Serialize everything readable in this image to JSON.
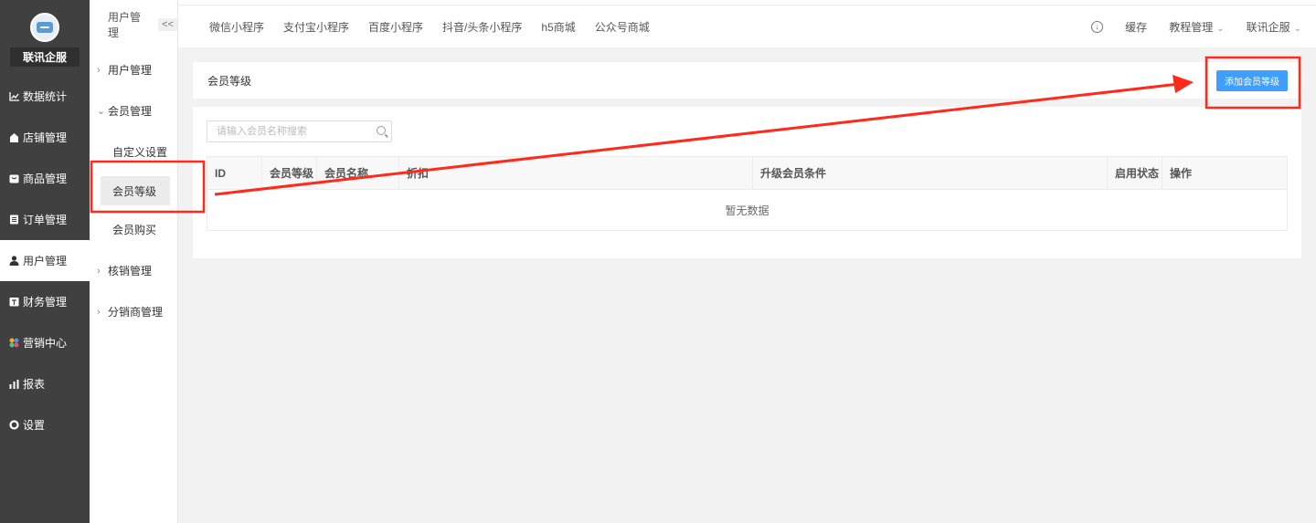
{
  "sidebar": {
    "brand": "联讯企服",
    "items": [
      {
        "label": "数据统计",
        "icon": "chart-icon"
      },
      {
        "label": "店铺管理",
        "icon": "store-icon"
      },
      {
        "label": "商品管理",
        "icon": "goods-icon"
      },
      {
        "label": "订单管理",
        "icon": "order-icon"
      },
      {
        "label": "用户管理",
        "icon": "user-icon",
        "active": true
      },
      {
        "label": "财务管理",
        "icon": "finance-icon"
      },
      {
        "label": "营销中心",
        "icon": "marketing-icon"
      },
      {
        "label": "报表",
        "icon": "report-icon"
      },
      {
        "label": "设置",
        "icon": "settings-icon"
      }
    ]
  },
  "subsidebar": {
    "title": "用户管理",
    "collapse": "<<",
    "groups": [
      {
        "label": "用户管理"
      },
      {
        "label": "会员管理",
        "children": [
          "自定义设置",
          "会员等级",
          "会员购买"
        ]
      },
      {
        "label": "核销管理"
      },
      {
        "label": "分销商管理"
      }
    ]
  },
  "topbar": {
    "tabs": [
      "微信小程序",
      "支付宝小程序",
      "百度小程序",
      "抖音/头条小程序",
      "h5商城",
      "公众号商城"
    ],
    "right": {
      "cache": "缓存",
      "tutorial": "教程管理",
      "account": "联讯企服"
    }
  },
  "main": {
    "card_title": "会员等级",
    "add_button": "添加会员等级",
    "search_placeholder": "请输入会员名称搜索",
    "table": {
      "columns": [
        "ID",
        "会员等级",
        "会员名称",
        "折扣",
        "升级会员条件",
        "启用状态",
        "操作"
      ],
      "empty_text": "暂无数据"
    }
  },
  "colors": {
    "sidebar_bg": "#404040",
    "primary": "#409eff",
    "annotation": "#ff2a1a"
  }
}
